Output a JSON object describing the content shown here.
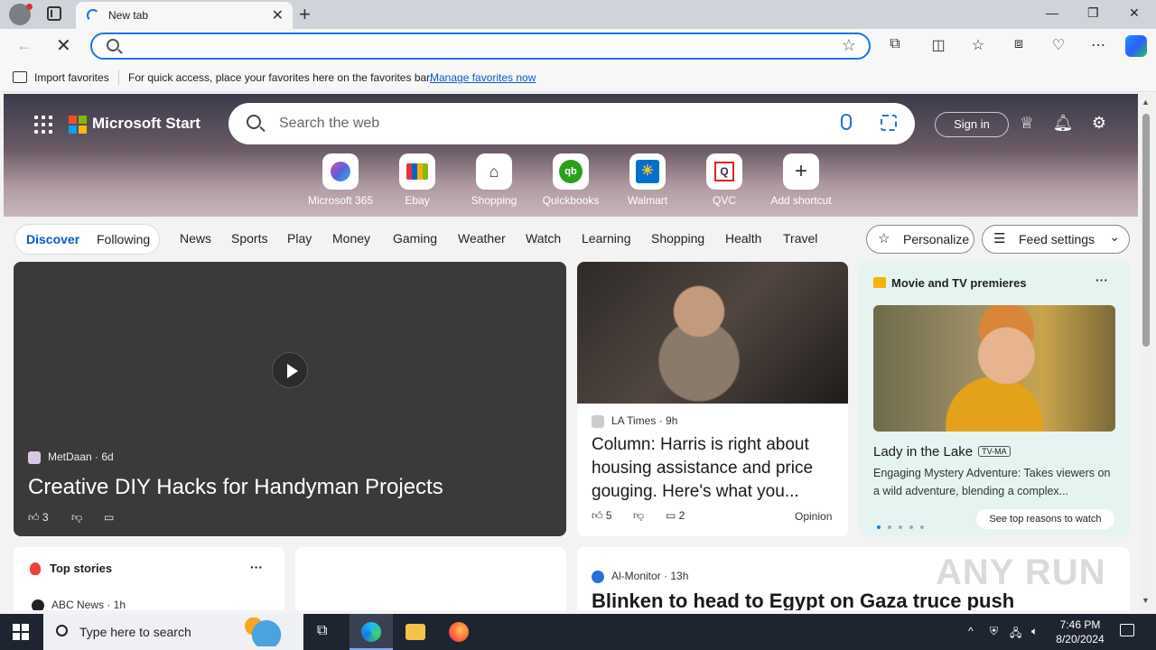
{
  "browser": {
    "tab_title": "New tab",
    "address_value": "",
    "favorites": {
      "import_label": "Import favorites",
      "hint": "For quick access, place your favorites here on the favorites bar.",
      "manage_link": "Manage favorites now"
    }
  },
  "hero": {
    "brand": "Microsoft Start",
    "search_placeholder": "Search the web",
    "signin_label": "Sign in",
    "shortcuts": [
      {
        "label": "Microsoft 365",
        "icon": "microsoft365-icon"
      },
      {
        "label": "Ebay",
        "icon": "ebay-icon"
      },
      {
        "label": "Shopping",
        "icon": "shopping-tag-icon"
      },
      {
        "label": "Quickbooks",
        "icon": "quickbooks-icon"
      },
      {
        "label": "Walmart",
        "icon": "walmart-icon"
      },
      {
        "label": "QVC",
        "icon": "qvc-icon"
      },
      {
        "label": "Add shortcut",
        "icon": "plus-icon"
      }
    ]
  },
  "nav": {
    "discover": "Discover",
    "following": "Following",
    "items": [
      "News",
      "Sports",
      "Play",
      "Money",
      "Gaming",
      "Weather",
      "Watch",
      "Learning",
      "Shopping",
      "Health",
      "Travel"
    ],
    "personalize": "Personalize",
    "feed_settings": "Feed settings"
  },
  "cards": {
    "video": {
      "source": "MetDaan · 6d",
      "title": "Creative DIY Hacks for Handyman Projects",
      "likes": "3"
    },
    "latimes": {
      "source": "LA Times · 9h",
      "title": "Column: Harris is right about housing assistance and price gouging. Here's what you...",
      "likes": "5",
      "comments": "2",
      "tag": "Opinion"
    },
    "movies": {
      "heading": "Movie and TV premieres",
      "title": "Lady in the Lake",
      "rating": "TV-MA",
      "desc": "Engaging Mystery Adventure: Takes viewers on a wild adventure, blending a complex...",
      "cta": "See top reasons to watch"
    },
    "top_stories": {
      "heading": "Top stories",
      "source": "ABC News · 1h"
    },
    "almonitor": {
      "source": "Al-Monitor · 13h",
      "title": "Blinken to head to Egypt on Gaza truce push"
    }
  },
  "watermark": "ANY RUN",
  "taskbar": {
    "search_placeholder": "Type here to search",
    "time": "7:46 PM",
    "date": "8/20/2024"
  },
  "colors": {
    "accent": "#0b57d0",
    "address_border": "#1a73e8",
    "taskbar": "#1f2530"
  }
}
